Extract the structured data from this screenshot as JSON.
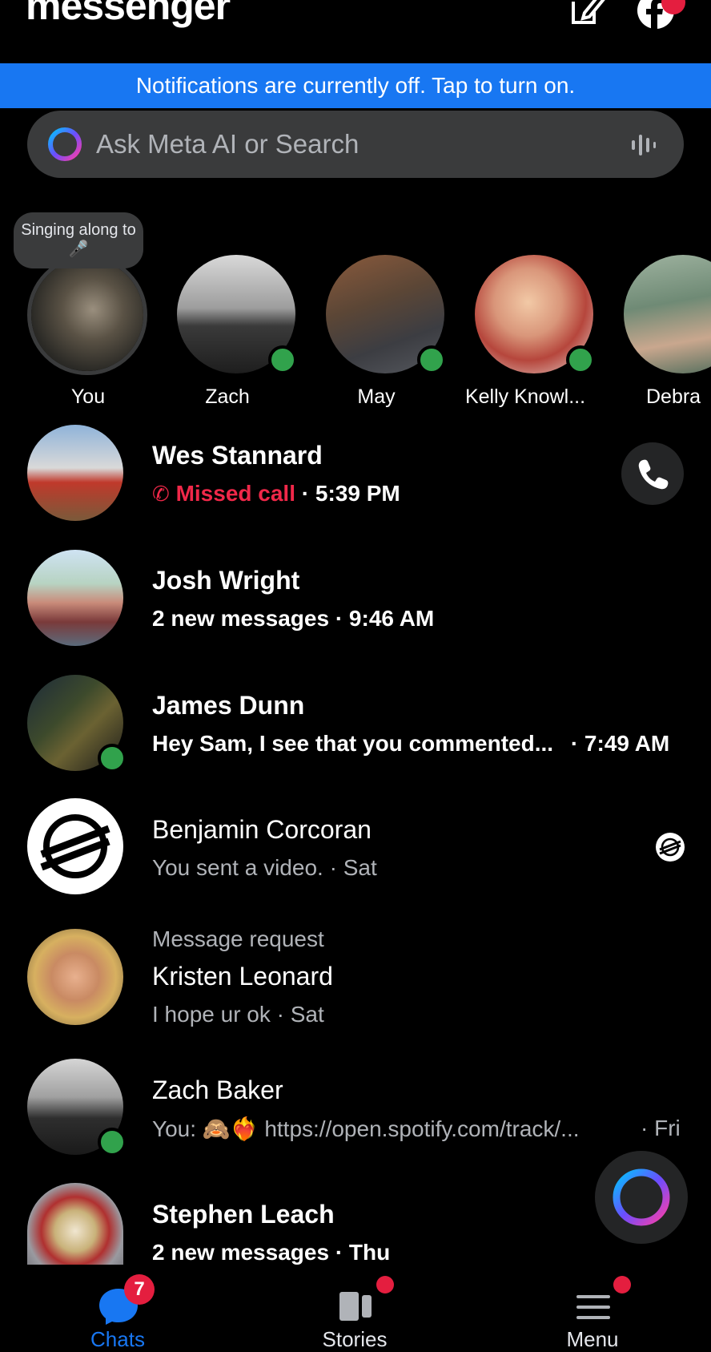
{
  "header": {
    "title": "messenger",
    "compose_icon": "compose-icon",
    "facebook_icon": "facebook-icon"
  },
  "notification_banner": "Notifications are currently off. Tap to turn on.",
  "search": {
    "placeholder": "Ask Meta AI or Search",
    "meta_ai_icon": "meta-ai-ring-icon",
    "voice_icon": "voice-waveform-icon"
  },
  "stories": {
    "tooltip": "Singing along to 🎤",
    "items": [
      {
        "name": "You",
        "online": false
      },
      {
        "name": "Zach",
        "online": true
      },
      {
        "name": "May",
        "online": true
      },
      {
        "name": "Kelly Knowl...",
        "online": true
      },
      {
        "name": "Debra",
        "online": false
      }
    ]
  },
  "chats": [
    {
      "name": "Wes Stannard",
      "status": "Missed call",
      "time": "· 5:39 PM",
      "bold": true
    },
    {
      "name": "Josh Wright",
      "preview": "2 new messages",
      "time": "· 9:46 AM",
      "bold": true
    },
    {
      "name": "James Dunn",
      "preview": "Hey Sam, I see that you commented...",
      "time": "· 7:49 AM",
      "bold": true
    },
    {
      "name": "Benjamin Corcoran",
      "preview": "You sent a video.",
      "time": "· Sat",
      "bold": false
    },
    {
      "label": "Message request",
      "name": "Kristen Leonard",
      "preview": "I hope ur ok",
      "time": "· Sat",
      "bold": false
    },
    {
      "name": "Zach Baker",
      "preview": "You: 🙈❤️‍🔥 https://open.spotify.com/track/...",
      "time": "· Fri",
      "bold": false
    },
    {
      "name": "Stephen Leach",
      "preview": "2 new messages",
      "time": "· Thu",
      "bold": true
    }
  ],
  "bottom_nav": {
    "chats": {
      "label": "Chats",
      "badge": "7"
    },
    "stories": {
      "label": "Stories"
    },
    "menu": {
      "label": "Menu"
    }
  },
  "colors": {
    "accent": "#1877f2",
    "missed": "#f02849",
    "online": "#31a24c",
    "badge": "#e41e3f"
  }
}
